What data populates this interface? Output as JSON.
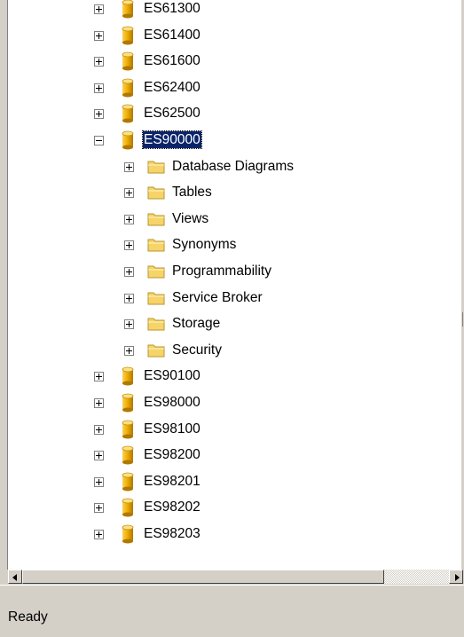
{
  "tree": {
    "items": [
      {
        "label": "ES61300",
        "kind": "database",
        "level": 0,
        "expanded": false
      },
      {
        "label": "ES61400",
        "kind": "database",
        "level": 0,
        "expanded": false
      },
      {
        "label": "ES61600",
        "kind": "database",
        "level": 0,
        "expanded": false
      },
      {
        "label": "ES62400",
        "kind": "database",
        "level": 0,
        "expanded": false
      },
      {
        "label": "ES62500",
        "kind": "database",
        "level": 0,
        "expanded": false
      },
      {
        "label": "ES90000",
        "kind": "database",
        "level": 0,
        "expanded": true,
        "selected": true
      },
      {
        "label": "Database Diagrams",
        "kind": "folder",
        "level": 1,
        "expanded": false
      },
      {
        "label": "Tables",
        "kind": "folder",
        "level": 1,
        "expanded": false
      },
      {
        "label": "Views",
        "kind": "folder",
        "level": 1,
        "expanded": false
      },
      {
        "label": "Synonyms",
        "kind": "folder",
        "level": 1,
        "expanded": false
      },
      {
        "label": "Programmability",
        "kind": "folder",
        "level": 1,
        "expanded": false
      },
      {
        "label": "Service Broker",
        "kind": "folder",
        "level": 1,
        "expanded": false
      },
      {
        "label": "Storage",
        "kind": "folder",
        "level": 1,
        "expanded": false
      },
      {
        "label": "Security",
        "kind": "folder",
        "level": 1,
        "expanded": false
      },
      {
        "label": "ES90100",
        "kind": "database",
        "level": 0,
        "expanded": false
      },
      {
        "label": "ES98000",
        "kind": "database",
        "level": 0,
        "expanded": false
      },
      {
        "label": "ES98100",
        "kind": "database",
        "level": 0,
        "expanded": false
      },
      {
        "label": "ES98200",
        "kind": "database",
        "level": 0,
        "expanded": false
      },
      {
        "label": "ES98201",
        "kind": "database",
        "level": 0,
        "expanded": false
      },
      {
        "label": "ES98202",
        "kind": "database",
        "level": 0,
        "expanded": false
      },
      {
        "label": "ES98203",
        "kind": "database",
        "level": 0,
        "expanded": false
      }
    ]
  },
  "icons": {
    "database": "database-cylinder-icon",
    "folder": "folder-icon",
    "expand": "plus-box-icon",
    "collapse": "minus-box-icon",
    "scroll_left": "arrow-left-icon",
    "scroll_right": "arrow-right-icon"
  },
  "colors": {
    "selection_bg": "#0a246a",
    "selection_fg": "#ffffff",
    "database_gold": "#e8a800",
    "folder_yellow": "#f6d46a",
    "chrome": "#d4d0c8"
  },
  "status_bar": {
    "text": "Ready"
  }
}
